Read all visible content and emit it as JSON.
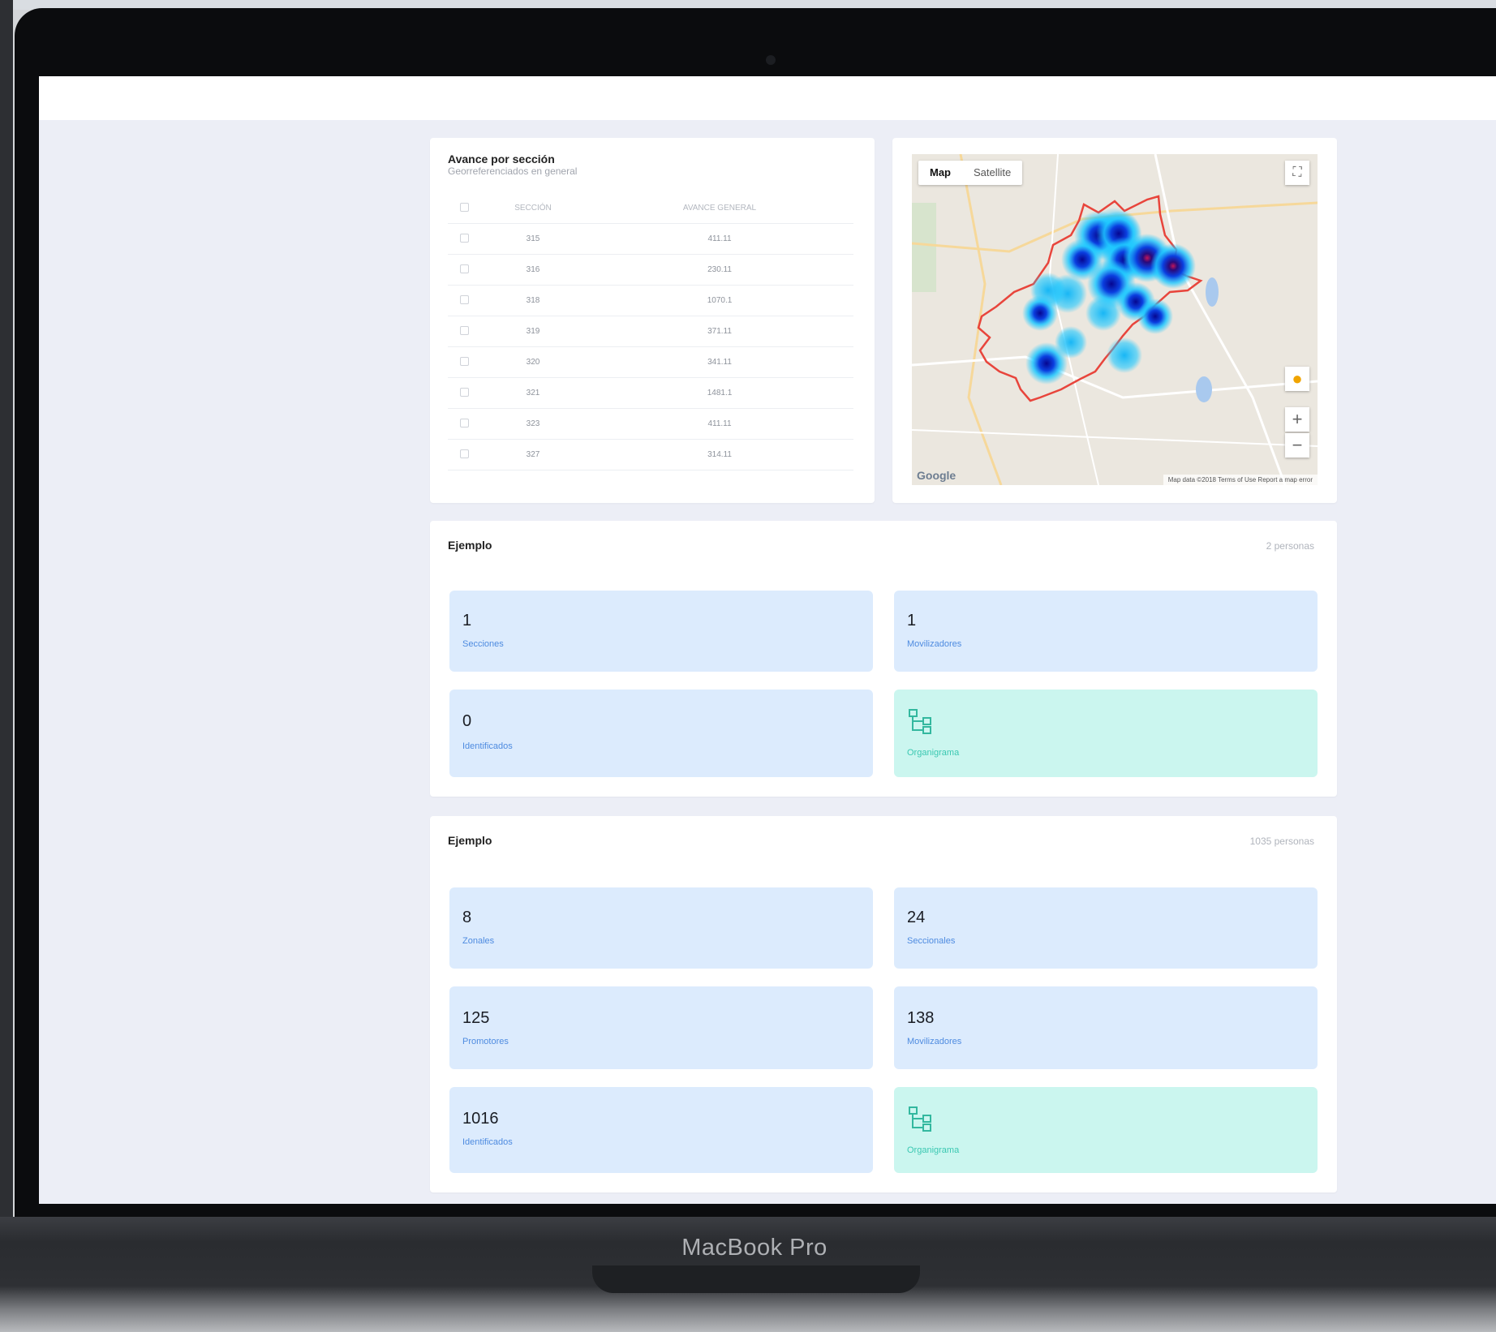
{
  "device": {
    "label": "MacBook Pro"
  },
  "section_table": {
    "title": "Avance por sección",
    "subtitle": "Georreferenciados en general",
    "columns": [
      "",
      "SECCIÓN",
      "AVANCE GENERAL"
    ],
    "rows": [
      [
        "315",
        "411.11"
      ],
      [
        "316",
        "230.11"
      ],
      [
        "318",
        "1070.1"
      ],
      [
        "319",
        "371.11"
      ],
      [
        "320",
        "341.11"
      ],
      [
        "321",
        "1481.1"
      ],
      [
        "323",
        "411.11"
      ],
      [
        "327",
        "314.11"
      ]
    ]
  },
  "map": {
    "tabs": [
      "Map",
      "Satellite"
    ],
    "active_tab": "Map",
    "provider": "Google",
    "footer": "Map data ©2018 Terms of Use   Report a map error",
    "fullscreen_icon": "fullscreen-icon",
    "pegman_icon": "pegman-icon",
    "zoom_in": "+",
    "zoom_out": "−"
  },
  "card_1": {
    "title": "Ejemplo",
    "meta": "2 personas",
    "tiles": [
      {
        "value": "1",
        "label": "Secciones",
        "style": "blue"
      },
      {
        "value": "1",
        "label": "Movilizadores",
        "style": "blue"
      },
      {
        "value": "0",
        "label": "Identificados",
        "style": "blue"
      },
      {
        "icon": "org-chart-icon",
        "label": "Organigrama",
        "style": "teal"
      }
    ]
  },
  "card_2": {
    "title": "Ejemplo",
    "meta": "1035 personas",
    "tiles": [
      {
        "value": "8",
        "label": "Zonales",
        "style": "blue"
      },
      {
        "value": "24",
        "label": "Seccionales",
        "style": "blue"
      },
      {
        "value": "125",
        "label": "Promotores",
        "style": "blue"
      },
      {
        "value": "138",
        "label": "Movilizadores",
        "style": "blue"
      },
      {
        "value": "1016",
        "label": "Identificados",
        "style": "blue"
      },
      {
        "icon": "org-chart-icon",
        "label": "Organigrama",
        "style": "teal"
      }
    ]
  },
  "colors": {
    "screen_bg": "#eceef6",
    "tile_blue": "#dcebfd",
    "tile_teal": "#cbf6ef",
    "label_blue": "#4e8be0",
    "label_teal": "#3bc8b2",
    "map_boundary": "#e8453c",
    "heat_core": "#0a0a9a",
    "heat_outer": "#1ec8ff"
  }
}
